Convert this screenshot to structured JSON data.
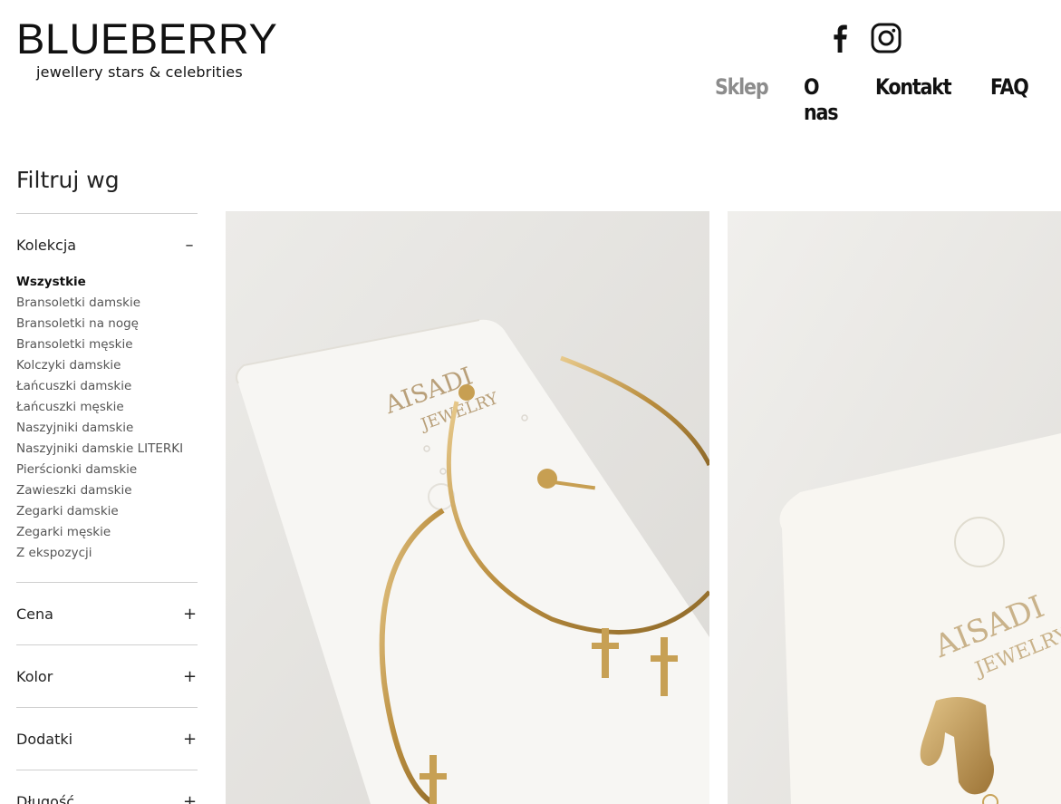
{
  "header": {
    "logo_title": "BLUEBERRY",
    "logo_tagline": "jewellery stars & celebrities",
    "social": [
      "facebook-icon",
      "instagram-icon"
    ],
    "nav": [
      {
        "label": "Sklep",
        "active": true
      },
      {
        "label": "O nas",
        "active": false
      },
      {
        "label": "Kontakt",
        "active": false
      },
      {
        "label": "FAQ",
        "active": false
      }
    ]
  },
  "sidebar": {
    "title": "Filtruj wg",
    "sections": [
      {
        "label": "Kolekcja",
        "expanded": true,
        "toggle": "–"
      },
      {
        "label": "Cena",
        "expanded": false,
        "toggle": "+"
      },
      {
        "label": "Kolor",
        "expanded": false,
        "toggle": "+"
      },
      {
        "label": "Dodatki",
        "expanded": false,
        "toggle": "+"
      },
      {
        "label": "Długość",
        "expanded": false,
        "toggle": "+"
      }
    ],
    "collections": [
      "Wszystkie",
      "Bransoletki damskie",
      "Bransoletki na nogę",
      "Bransoletki męskie",
      "Kolczyki damskie",
      "Łańcuszki damskie",
      "Łańcuszki męskie",
      "Naszyjniki damskie",
      "Naszyjniki damskie LITERKI",
      "Pierścionki damskie",
      "Zawieszki damskie",
      "Zegarki damskie",
      "Zegarki męskie",
      "Z ekspozycji"
    ],
    "selected_collection": "Wszystkie"
  },
  "products": [
    {
      "card_text": [
        "AISADI",
        "JEWELRY"
      ]
    },
    {
      "card_text": [
        "AISADI",
        "JEWELRY"
      ]
    }
  ],
  "colors": {
    "text": "#111111",
    "nav_active": "#8c8c8c",
    "divider": "#cfcfcf",
    "gold": "#c9a45c"
  }
}
